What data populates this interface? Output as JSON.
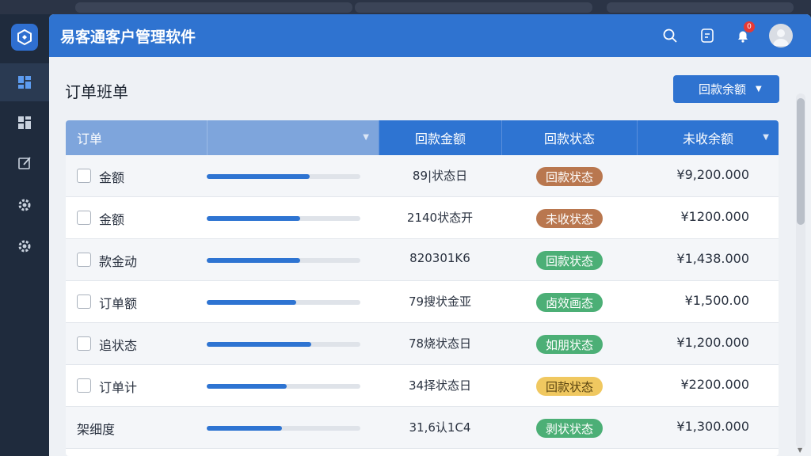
{
  "app": {
    "title": "易客通客户管理软件",
    "notification_count": "0"
  },
  "page": {
    "title": "订单班单",
    "action_button": "回款余额"
  },
  "table": {
    "headers": [
      "订单",
      "",
      "回款金额",
      "回款状态",
      "未收余额"
    ],
    "rows": [
      {
        "name": "金额",
        "progress": 0.67,
        "col3": "89|状态日",
        "status": "回款状态",
        "status_color": "#b9774f",
        "amount": "¥9,200.000",
        "checkbox": true
      },
      {
        "name": "金额",
        "progress": 0.61,
        "col3": "2140状态开",
        "status": "未收状态",
        "status_color": "#b9774f",
        "amount": "¥1200.000",
        "checkbox": true
      },
      {
        "name": "款金动",
        "progress": 0.61,
        "col3": "820301K6",
        "status": "回款状态",
        "status_color": "#4caf76",
        "amount": "¥1,438.000",
        "checkbox": true
      },
      {
        "name": "订单额",
        "progress": 0.58,
        "col3": "79搜状金亚",
        "status": "卤效画态",
        "status_color": "#4caf76",
        "amount": "¥1,500.00",
        "checkbox": true
      },
      {
        "name": "追状态",
        "progress": 0.68,
        "col3": "78烧状态日",
        "status": "如朋状态",
        "status_color": "#4caf76",
        "amount": "¥1,200.000",
        "checkbox": true
      },
      {
        "name": "订单计",
        "progress": 0.52,
        "col3": "34择状态日",
        "status": "回款状态",
        "status_color": "#f0c860",
        "amount": "¥2200.000",
        "checkbox": true
      },
      {
        "name": "架细度",
        "progress": 0.49,
        "col3": "31,6认1C4",
        "status": "剥状状态",
        "status_color": "#4caf76",
        "amount": "¥1,300.000",
        "checkbox": false
      }
    ]
  },
  "colors": {
    "brand": "#2f73d0",
    "rail": "#1f2b3d",
    "status_green": "#4caf76",
    "status_brown": "#b9774f",
    "status_yellow": "#f0c860"
  },
  "icons": {
    "rail": [
      "dashboard-icon",
      "grid-icon",
      "edit-icon",
      "settings-icon",
      "settings-icon"
    ],
    "titlebar": [
      "search-icon",
      "message-icon",
      "bell-icon",
      "user-avatar"
    ]
  }
}
